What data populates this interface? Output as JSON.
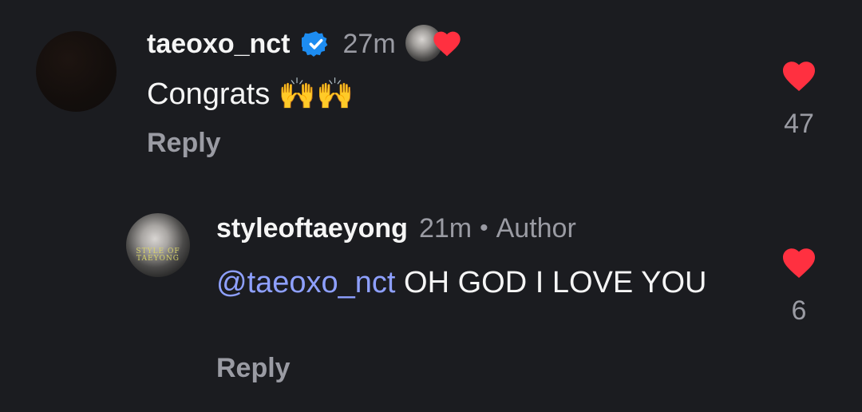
{
  "comments": [
    {
      "username": "taeoxo_nct",
      "verified": true,
      "time": "27m",
      "liked_by_author_avatar_text": "STYLE OF TAEYONG",
      "text": "Congrats ",
      "emoji": "🙌🙌",
      "reply_label": "Reply",
      "like_count": "47"
    },
    {
      "username": "styleoftaeyong",
      "time": "21m",
      "separator": "•",
      "author_badge": "Author",
      "avatar_text": "STYLE OF TAEYONG",
      "mention": "@taeoxo_nct",
      "text": " OH GOD I LOVE YOU",
      "reply_label": "Reply",
      "like_count": "6"
    }
  ],
  "colors": {
    "background": "#1b1c20",
    "heart": "#ff3040",
    "muted_text": "#9a9ba3",
    "mention": "#8ea0ff",
    "verified": "#1d8cf0"
  },
  "icons": {
    "verified": "verified-badge-icon",
    "like": "heart-icon",
    "mention": "threads-at-icon"
  }
}
